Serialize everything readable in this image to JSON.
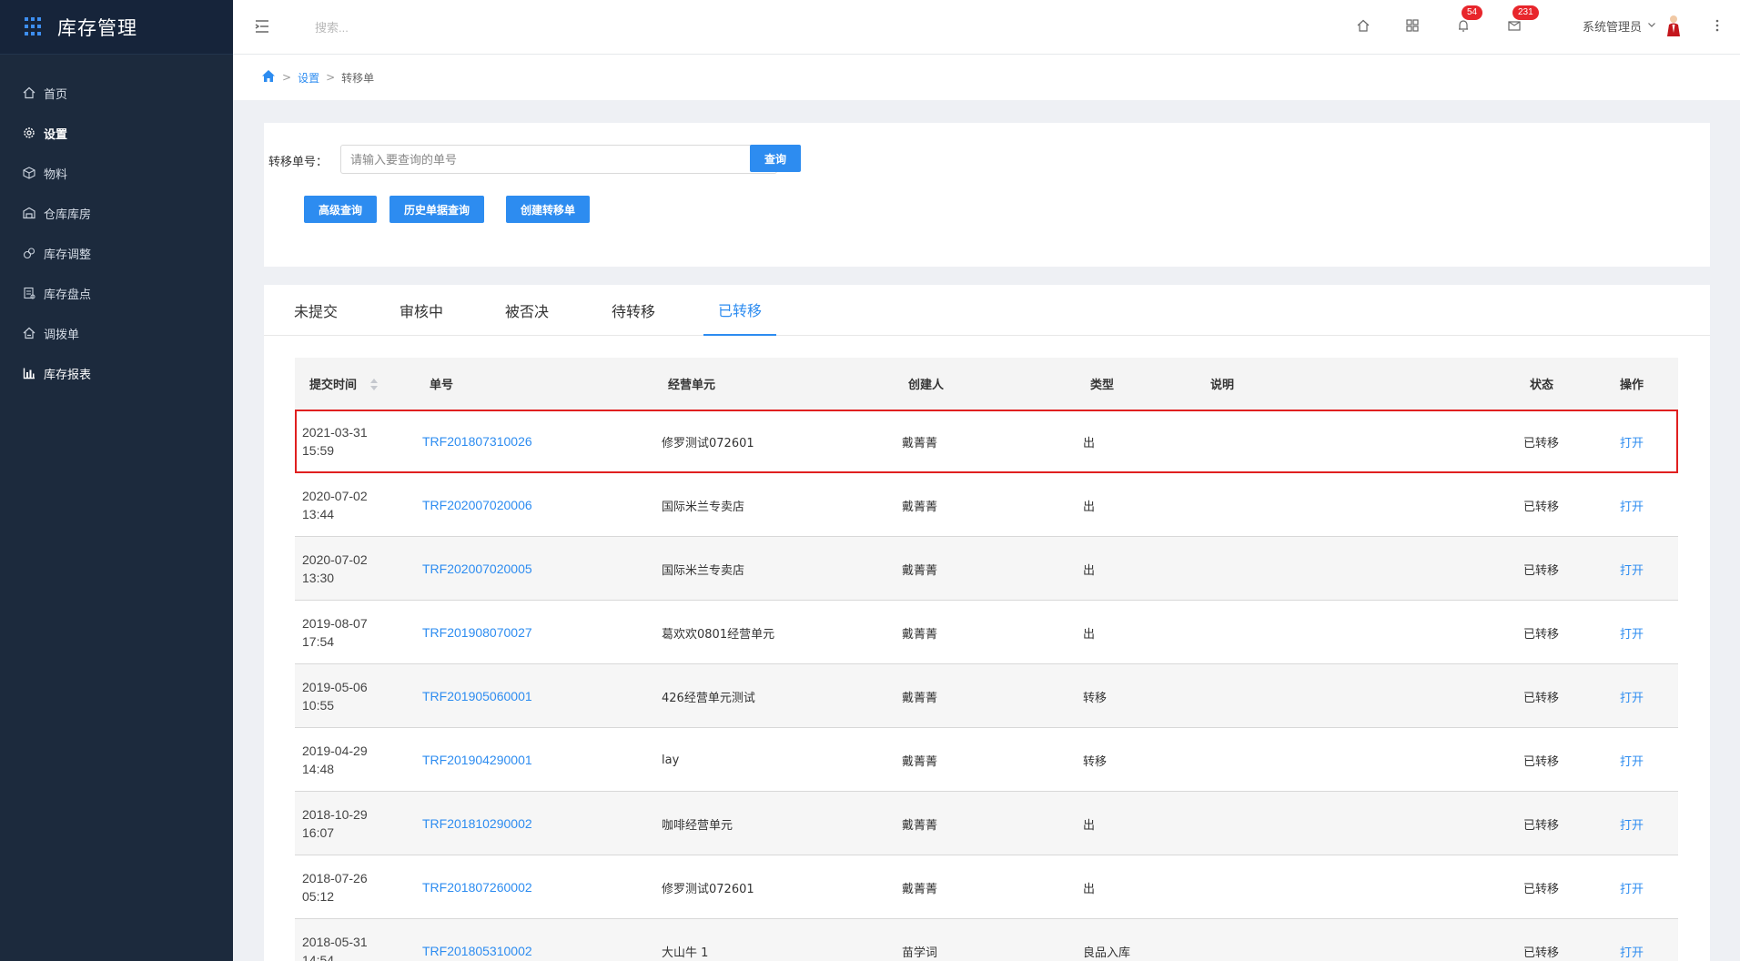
{
  "app": {
    "title": "库存管理"
  },
  "sidebar": {
    "items": [
      {
        "label": "首页",
        "icon": "home-icon"
      },
      {
        "label": "设置",
        "icon": "gear-icon",
        "active": true
      },
      {
        "label": "物料",
        "icon": "cube-icon"
      },
      {
        "label": "仓库库房",
        "icon": "warehouse-icon"
      },
      {
        "label": "库存调整",
        "icon": "adjust-icon"
      },
      {
        "label": "库存盘点",
        "icon": "checklist-icon"
      },
      {
        "label": "调拨单",
        "icon": "transfer-icon"
      },
      {
        "label": "库存报表",
        "icon": "bar-chart-icon"
      }
    ]
  },
  "header": {
    "search_placeholder": "搜索...",
    "notifications_count": "54",
    "messages_count": "231",
    "user_name": "系统管理员"
  },
  "breadcrumb": {
    "level1": "设置",
    "level2": "转移单"
  },
  "search": {
    "label": "转移单号：",
    "placeholder": "请输入要查询的单号",
    "query_button": "查询",
    "advanced_button": "高级查询",
    "history_button": "历史单据查询",
    "create_button": "创建转移单"
  },
  "tabs": [
    {
      "label": "未提交"
    },
    {
      "label": "审核中"
    },
    {
      "label": "被否决"
    },
    {
      "label": "待转移"
    },
    {
      "label": "已转移",
      "active": true
    }
  ],
  "table": {
    "columns": {
      "time": "提交时间",
      "number": "单号",
      "unit": "经营单元",
      "creator": "创建人",
      "type": "类型",
      "note": "说明",
      "status": "状态",
      "action": "操作"
    },
    "rows": [
      {
        "date": "2021-03-31",
        "time": "15:59",
        "number": "TRF201807310026",
        "unit": "修罗测试072601",
        "creator": "戴菁菁",
        "type": "出",
        "note": "",
        "status": "已转移",
        "action": "打开"
      },
      {
        "date": "2020-07-02",
        "time": "13:44",
        "number": "TRF202007020006",
        "unit": "国际米兰专卖店",
        "creator": "戴菁菁",
        "type": "出",
        "note": "",
        "status": "已转移",
        "action": "打开"
      },
      {
        "date": "2020-07-02",
        "time": "13:30",
        "number": "TRF202007020005",
        "unit": "国际米兰专卖店",
        "creator": "戴菁菁",
        "type": "出",
        "note": "",
        "status": "已转移",
        "action": "打开"
      },
      {
        "date": "2019-08-07",
        "time": "17:54",
        "number": "TRF201908070027",
        "unit": "葛欢欢0801经营单元",
        "creator": "戴菁菁",
        "type": "出",
        "note": "",
        "status": "已转移",
        "action": "打开"
      },
      {
        "date": "2019-05-06",
        "time": "10:55",
        "number": "TRF201905060001",
        "unit": "426经营单元测试",
        "creator": "戴菁菁",
        "type": "转移",
        "note": "",
        "status": "已转移",
        "action": "打开"
      },
      {
        "date": "2019-04-29",
        "time": "14:48",
        "number": "TRF201904290001",
        "unit": "lay",
        "creator": "戴菁菁",
        "type": "转移",
        "note": "",
        "status": "已转移",
        "action": "打开"
      },
      {
        "date": "2018-10-29",
        "time": "16:07",
        "number": "TRF201810290002",
        "unit": "咖啡经营单元",
        "creator": "戴菁菁",
        "type": "出",
        "note": "",
        "status": "已转移",
        "action": "打开"
      },
      {
        "date": "2018-07-26",
        "time": "05:12",
        "number": "TRF201807260002",
        "unit": "修罗测试072601",
        "creator": "戴菁菁",
        "type": "出",
        "note": "",
        "status": "已转移",
        "action": "打开"
      },
      {
        "date": "2018-05-31",
        "time": "14:54",
        "number": "TRF201805310002",
        "unit": "大山牛 1",
        "creator": "苗学词",
        "type": "良品入库",
        "note": "",
        "status": "已转移",
        "action": "打开"
      }
    ]
  },
  "colors": {
    "primary": "#2d8cf0",
    "sidebar": "#1c2a3d",
    "highlight": "#e02020",
    "badge": "#e8262c"
  }
}
